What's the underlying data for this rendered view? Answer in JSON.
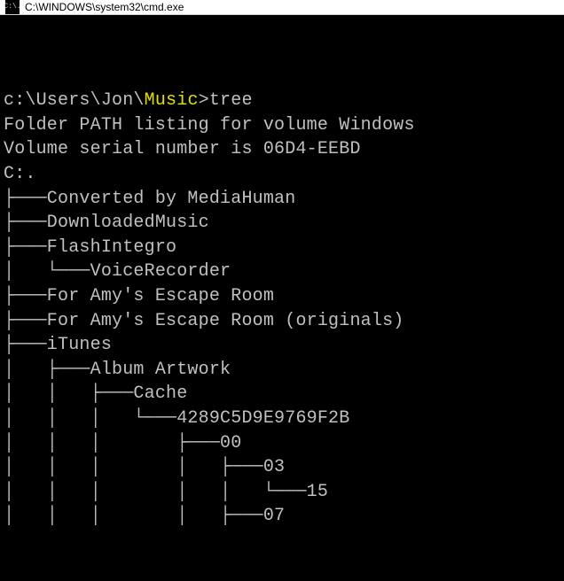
{
  "window": {
    "title": "C:\\WINDOWS\\system32\\cmd.exe",
    "icon_glyph": "C:\\."
  },
  "prompt": {
    "path": "c:\\Users\\Jon\\",
    "highlight": "Music",
    "sep": ">",
    "command": "tree"
  },
  "output": {
    "line0": "",
    "line1": "Folder PATH listing for volume Windows",
    "line2": "Volume serial number is 06D4-EEBD",
    "line3": "C:.",
    "line4": "├───Converted by MediaHuman",
    "line5": "├───DownloadedMusic",
    "line6": "├───FlashIntegro",
    "line7": "│   └───VoiceRecorder",
    "line8": "├───For Amy's Escape Room",
    "line9": "├───For Amy's Escape Room (originals)",
    "line10": "├───iTunes",
    "line11": "│   ├───Album Artwork",
    "line12": "│   │   ├───Cache",
    "line13": "│   │   │   └───4289C5D9E9769F2B",
    "line14": "│   │   │       ├───00",
    "line15": "│   │   │       │   ├───03",
    "line16": "│   │   │       │   │   └───15",
    "line17": "│   │   │       │   ├───07"
  }
}
